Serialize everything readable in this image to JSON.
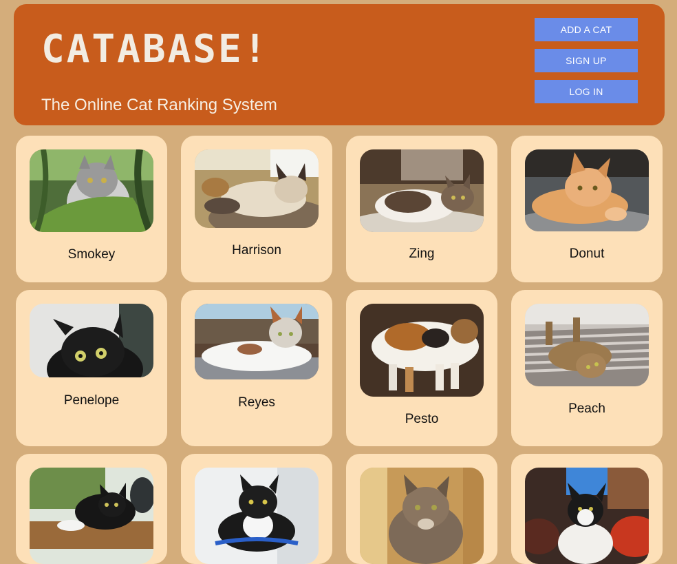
{
  "app": {
    "logo": "CATABASE!",
    "tagline": "The Online Cat Ranking System"
  },
  "nav": {
    "add_cat": "ADD A CAT",
    "sign_up": "SIGN UP",
    "log_in": "LOG IN"
  },
  "cats": [
    {
      "name": "Smokey"
    },
    {
      "name": "Harrison"
    },
    {
      "name": "Zing"
    },
    {
      "name": "Donut"
    },
    {
      "name": "Penelope"
    },
    {
      "name": "Reyes"
    },
    {
      "name": "Pesto"
    },
    {
      "name": "Peach"
    },
    {
      "name": ""
    },
    {
      "name": ""
    },
    {
      "name": ""
    },
    {
      "name": ""
    }
  ],
  "colors": {
    "page_bg": "#d4ad7b",
    "header_bg": "#c85c1c",
    "button_bg": "#6a8ce8",
    "card_bg": "#fde0b8"
  }
}
